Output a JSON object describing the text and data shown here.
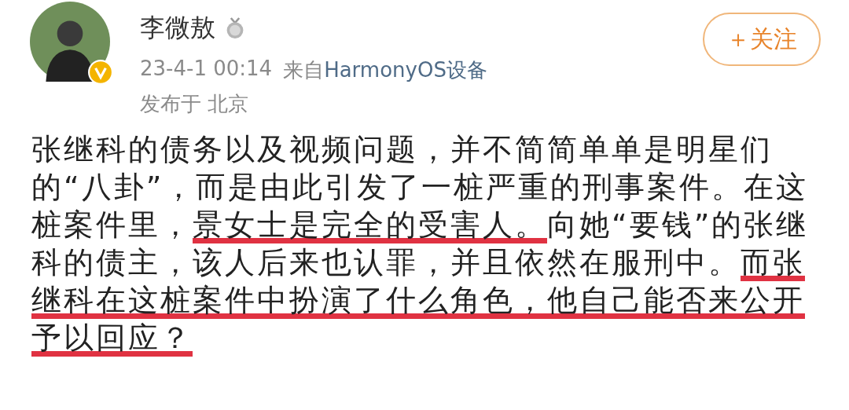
{
  "author": {
    "name": "李微敖",
    "verified": true,
    "has_medal": true
  },
  "meta": {
    "time": "23-4-1 00:14",
    "source_prefix": "来自",
    "source": "HarmonyOS设备",
    "location": "发布于 北京"
  },
  "follow_button": {
    "label": "＋关注"
  },
  "post": {
    "segments": [
      {
        "text": "张继科的债务以及视频问题，并不简简单单是明星们的“八卦”，而是由此引发了一桩严重的刑事案件。在这桩案件里，",
        "underlined": false
      },
      {
        "text": "景女士是完全的受害人。",
        "underlined": true
      },
      {
        "text": "向她“要钱”的张继科的债主，该人后来也认罪，并且依然在服刑中。",
        "underlined": false
      },
      {
        "text": "而张继科在这桩案件中扮演了什么角色，他自己能否来公开予以回应？",
        "underlined": true
      }
    ]
  }
}
